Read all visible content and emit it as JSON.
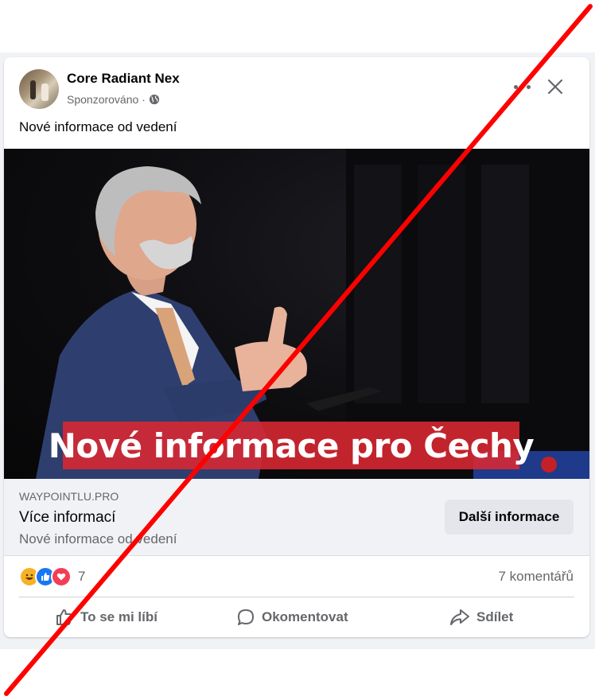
{
  "post": {
    "page_name": "Core Radiant Nex",
    "sponsored": "Sponzorováno",
    "separator": "·",
    "text": "Nové informace od vedení",
    "image_caption": "Nové informace pro Čechy"
  },
  "link": {
    "domain": "WAYPOINTLU.PRO",
    "title": "Více informací",
    "description": "Nové informace od vedení",
    "cta_label": "Další informace"
  },
  "stats": {
    "reactions": [
      "haha-icon",
      "like-icon",
      "love-icon"
    ],
    "reaction_count": "7",
    "comments": "7 komentářů"
  },
  "actions": {
    "like": "To se mi líbí",
    "comment": "Okomentovat",
    "share": "Sdílet"
  },
  "colors": {
    "like_blue": "#1877f2",
    "love_red": "#f33e58",
    "haha_yellow": "#f7b125",
    "banner_red": "#dc2832",
    "overlay_line": "#ff0000"
  }
}
